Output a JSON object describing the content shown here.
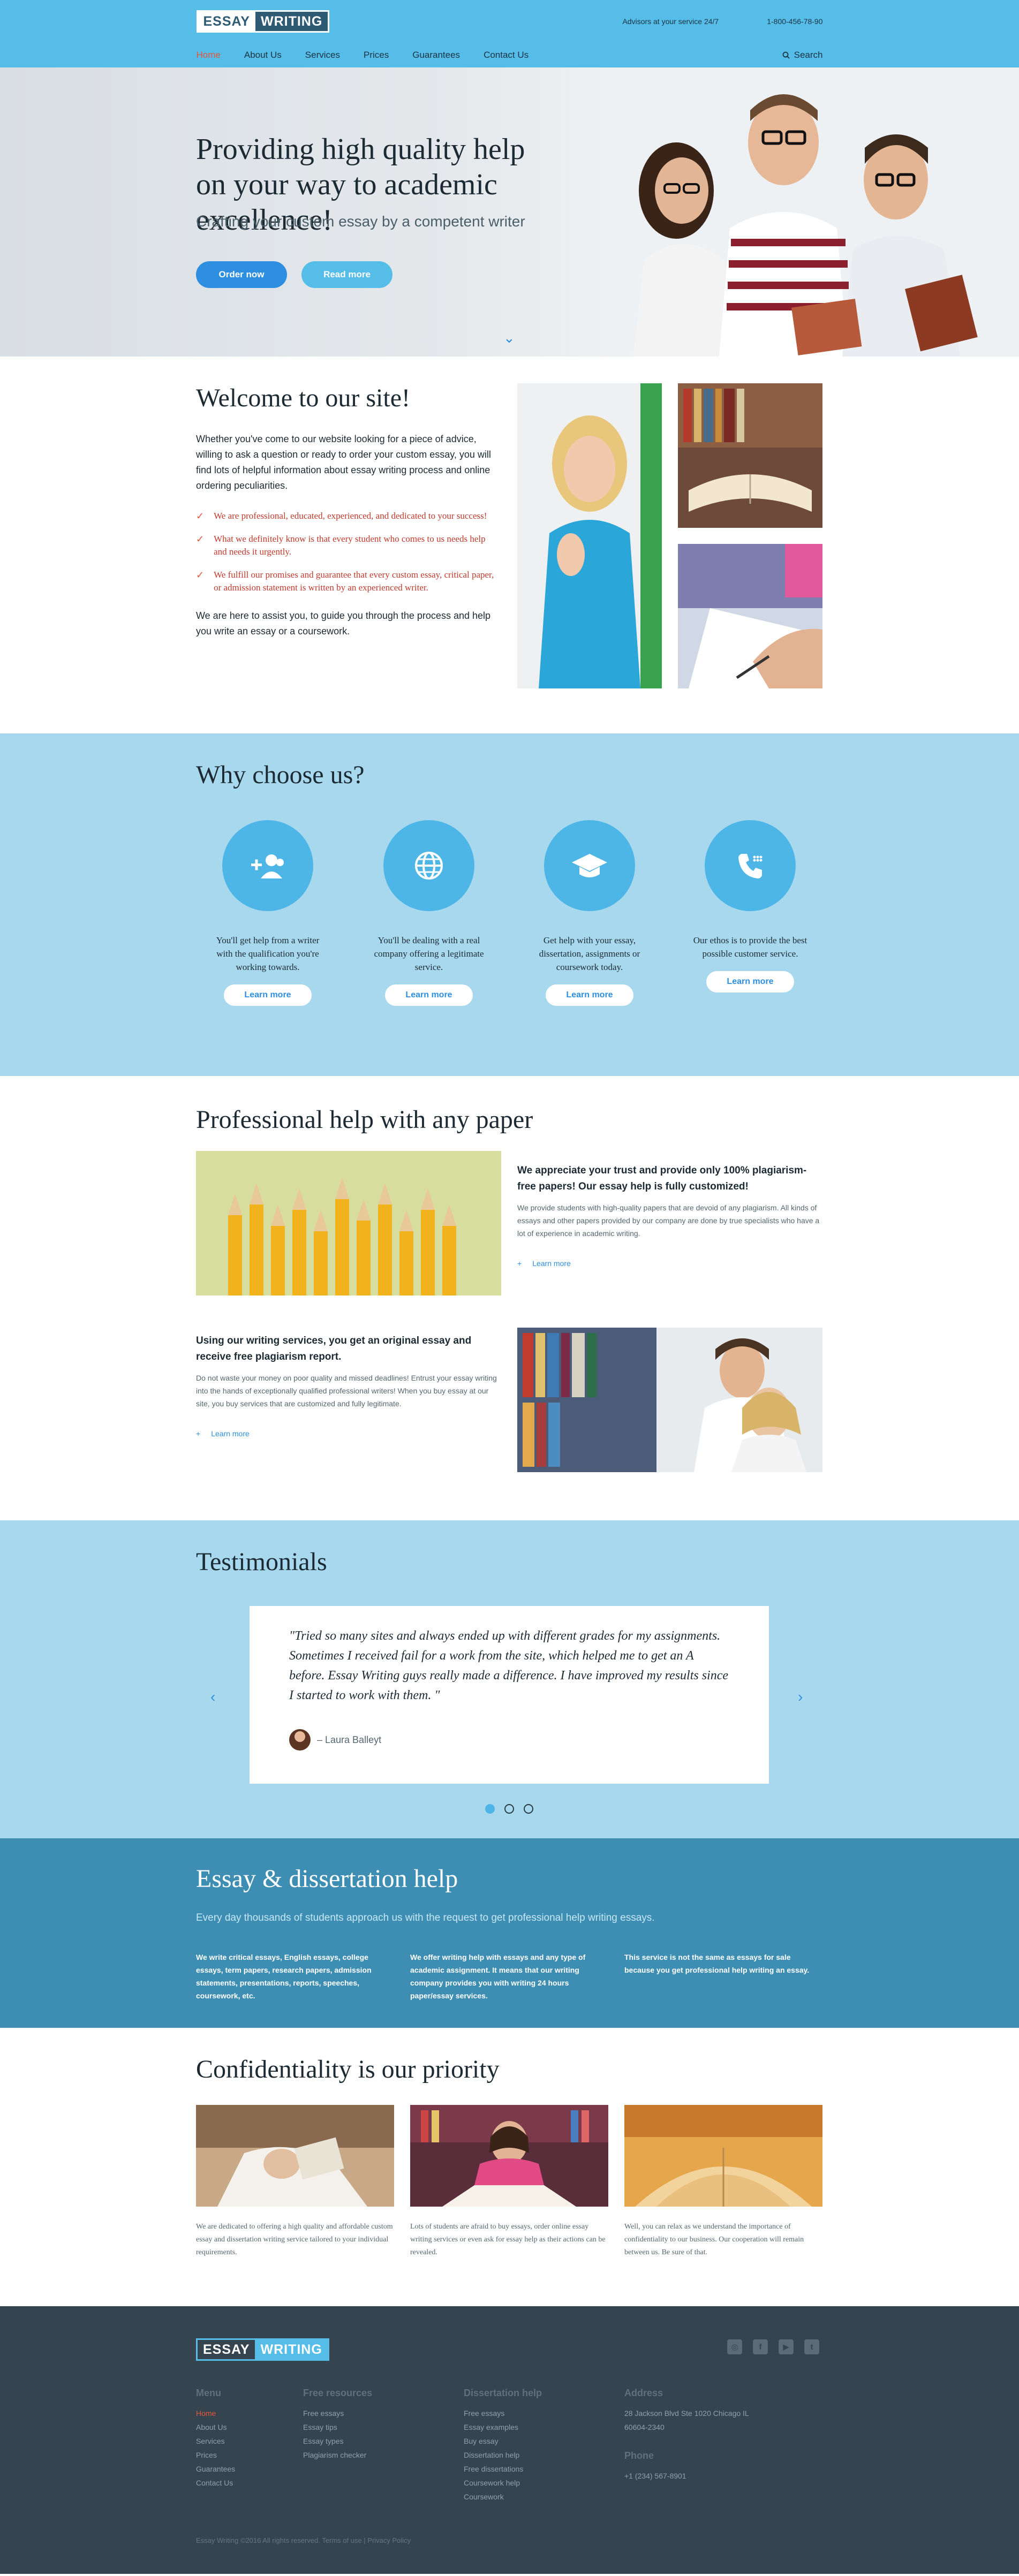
{
  "header": {
    "logo": {
      "part1": "ESSAY",
      "part2": "WRITING"
    },
    "advisors": "Advisors at your service 24/7",
    "phone": "1-800-456-78-90",
    "nav": [
      "Home",
      "About Us",
      "Services",
      "Prices",
      "Guarantees",
      "Contact Us"
    ],
    "search": "Search"
  },
  "hero": {
    "title": "Providing high quality help on your way to academic excellence!",
    "subtitle": "Crafting your custom essay by a competent writer",
    "order_btn": "Order now",
    "read_btn": "Read more"
  },
  "welcome": {
    "title": "Welcome to our site!",
    "intro": "Whether you've come to our website looking for a piece of advice, willing to ask a question or ready to order your custom essay, you will find lots of helpful information about essay writing process and online ordering peculiarities.",
    "checks": [
      "We are professional, educated, experienced, and dedicated to your success!",
      "What we definitely know is that every student who comes to us needs help and needs it urgently.",
      "We fulfill our promises and guarantee that every custom essay, critical paper, or admission statement is written by an experienced writer."
    ],
    "outro": "We are here to assist you, to guide you through the process and help you write an essay or a coursework."
  },
  "why": {
    "title": "Why choose us?",
    "features": [
      {
        "icon": "add-user-icon",
        "text": "You'll get help from a writer with the qualification you're working towards.",
        "btn": "Learn more"
      },
      {
        "icon": "globe-icon",
        "text": "You'll be dealing with a real company offering a legitimate service.",
        "btn": "Learn more"
      },
      {
        "icon": "graduation-cap-icon",
        "text": "Get help with your essay, dissertation, assignments or coursework today.",
        "btn": "Learn more"
      },
      {
        "icon": "phone-icon",
        "text": "Our ethos is to provide the best possible customer service.",
        "btn": "Learn more"
      }
    ]
  },
  "pro": {
    "title": "Professional help with any paper",
    "block1": {
      "heading": "We appreciate your trust and provide only 100% plagiarism-free papers! Our essay help is fully customized!",
      "desc": "We provide students with high-quality papers that are devoid of any plagiarism. All kinds of essays and other papers provided by our company are done by true specialists who have a lot of experience in academic writing.",
      "link": "Learn more"
    },
    "block2": {
      "heading": "Using our writing services, you get an original essay and receive free plagiarism report.",
      "desc": "Do not waste your money on poor quality and missed deadlines! Entrust your essay writing into the hands of exceptionally qualified professional writers! When you buy essay at our site, you buy services that are customized and fully legitimate.",
      "link": "Learn more"
    }
  },
  "testimonials": {
    "title": "Testimonials",
    "quote": "\"Tried so many sites and always ended up with different grades for my assignments. Sometimes I received fail for a work from the site, which helped me to get an A before. Essay Writing guys really made a difference. I have improved my results since I started to work with them. \"",
    "author": "– Laura Balleyt",
    "active_slide": 1,
    "slides": 3
  },
  "essay": {
    "title": "Essay & dissertation help",
    "lead": "Every day thousands of students approach us with the request to get professional help writing essays.",
    "cols": [
      "We write critical essays, English essays, college essays, term papers, research papers, admission statements, presentations, reports, speeches, coursework, etc.",
      "We offer writing help with essays and any type of academic assignment. It means that our writing company provides you with writing 24 hours paper/essay services.",
      "This service is not the same as essays for sale because you get professional help writing an essay."
    ]
  },
  "conf": {
    "title": "Confidentiality is our priority",
    "cols": [
      "We are dedicated to offering a high quality and affordable custom essay and dissertation writing service tailored to your individual requirements.",
      "Lots of students are afraid to buy essays, order online essay writing services or even ask for essay help as their actions can be revealed.",
      "Well, you can relax as we understand the importance of confidentiality to our business. Our cooperation will remain between us. Be sure of that."
    ]
  },
  "footer": {
    "menu_title": "Menu",
    "menu": [
      "Home",
      "About Us",
      "Services",
      "Prices",
      "Guarantees",
      "Contact Us"
    ],
    "resources_title": "Free resources",
    "resources": [
      "Free essays",
      "Essay tips",
      "Essay types",
      "Plagiarism checker"
    ],
    "diss_title": "Dissertation help",
    "diss": [
      "Free essays",
      "Essay examples",
      "Buy essay",
      "Dissertation help",
      "Free dissertations",
      "Coursework help",
      "Coursework"
    ],
    "address_title": "Address",
    "address": "28 Jackson Blvd Ste 1020 Chicago IL 60604-2340",
    "phone_title": "Phone",
    "phone": "+1 (234) 567-8901",
    "copyright": "Essay Writing ©2016 All rights reserved. Terms of use | Privacy Policy"
  }
}
